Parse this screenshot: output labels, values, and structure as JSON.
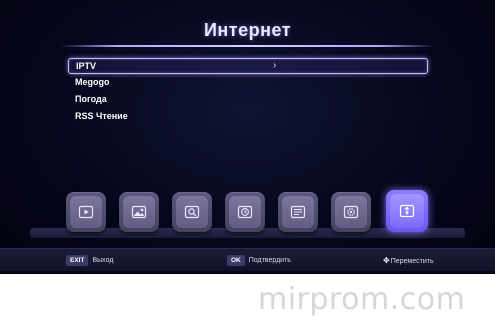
{
  "header": {
    "title": "Интернет"
  },
  "menu": {
    "items": [
      {
        "label": "IPTV",
        "selected": true,
        "chevron": "›"
      },
      {
        "label": "Megogo"
      },
      {
        "label": "Погода"
      },
      {
        "label": "RSS Чтение"
      }
    ]
  },
  "dock": {
    "items": [
      {
        "icon": "video-play-icon"
      },
      {
        "icon": "picture-icon"
      },
      {
        "icon": "search-icon"
      },
      {
        "icon": "clock-icon"
      },
      {
        "icon": "epg-list-icon"
      },
      {
        "icon": "settings-icon"
      },
      {
        "icon": "internet-usb-icon",
        "active": true
      }
    ],
    "active_color": "#7d6bf7"
  },
  "footer": {
    "exit_key": "EXIT",
    "exit_label": "Выход",
    "ok_key": "OK",
    "ok_label": "Подтвердить",
    "move_icon": "✥",
    "move_label": "Переместить"
  },
  "watermark": "mirprom.com"
}
